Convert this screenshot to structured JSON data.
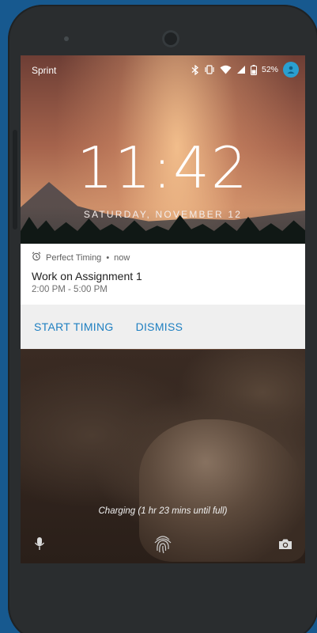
{
  "status_bar": {
    "carrier": "Sprint",
    "battery_percent": "52%",
    "icons": [
      "bluetooth-icon",
      "vibrate-icon",
      "wifi-icon",
      "cell-signal-icon",
      "battery-icon",
      "profile-icon"
    ]
  },
  "lock_screen": {
    "time": "11:42",
    "date": "SATURDAY, NOVEMBER 12"
  },
  "notification": {
    "app_name": "Perfect Timing",
    "separator": "•",
    "when": "now",
    "app_icon": "alarm-clock-icon",
    "title": "Work on Assignment 1",
    "text": "2:00 PM - 5:00 PM",
    "actions": {
      "primary": "START TIMING",
      "secondary": "DISMISS"
    },
    "accent_color": "#1e7fc1"
  },
  "footer": {
    "charging_text": "Charging (1 hr 23 mins until full)",
    "icons": [
      "microphone-icon",
      "fingerprint-icon",
      "camera-icon"
    ]
  }
}
